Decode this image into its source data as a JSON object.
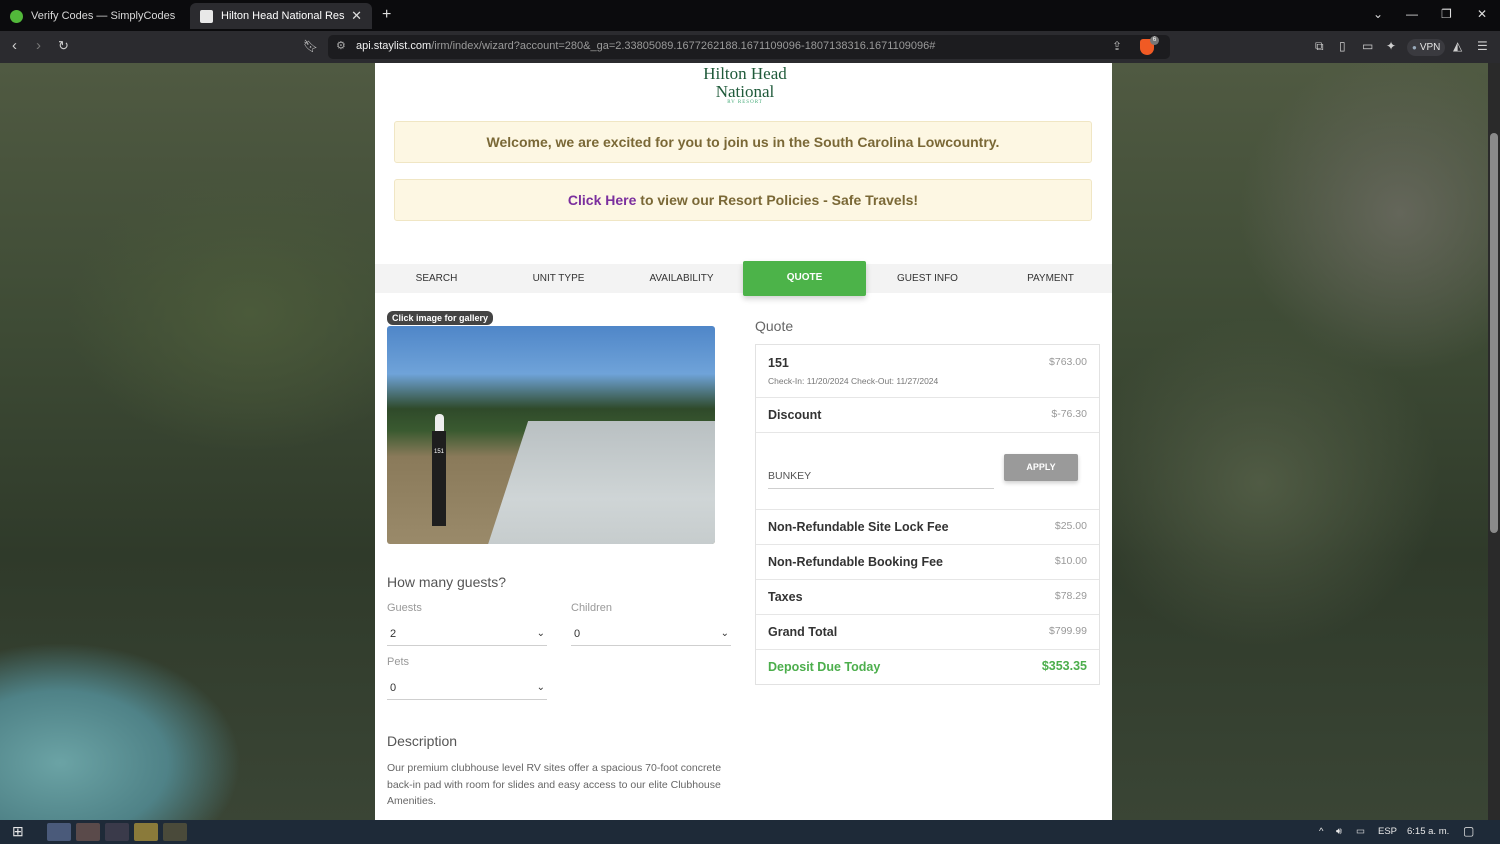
{
  "browser": {
    "tabs": [
      {
        "title": "Verify Codes — SimplyCodes",
        "active": false
      },
      {
        "title": "Hilton Head National Resort - C",
        "active": true
      }
    ],
    "url_host": "api.staylist.com",
    "url_path": "/irm/index/wizard?account=280&_ga=2.33805089.1677262188.1671109096-1807138316.1671109096#",
    "shield_badge": "6",
    "vpn_label": "VPN"
  },
  "brand": {
    "logo_line1": "Hilton Head",
    "logo_line2": "National",
    "logo_line3": "RV RESORT"
  },
  "notices": {
    "welcome": "Welcome, we are excited for you to join us in the South Carolina Lowcountry.",
    "policy_link": "Click Here",
    "policy_text": " to view our Resort Policies - Safe Travels!"
  },
  "steps": [
    {
      "label": "SEARCH",
      "active": false
    },
    {
      "label": "UNIT TYPE",
      "active": false
    },
    {
      "label": "AVAILABILITY",
      "active": false
    },
    {
      "label": "QUOTE",
      "active": true
    },
    {
      "label": "GUEST INFO",
      "active": false
    },
    {
      "label": "PAYMENT",
      "active": false
    }
  ],
  "gallery": {
    "tag": "Click image for gallery",
    "site_number": "151"
  },
  "guests": {
    "heading": "How many guests?",
    "guests_label": "Guests",
    "guests_value": "2",
    "children_label": "Children",
    "children_value": "0",
    "pets_label": "Pets",
    "pets_value": "0"
  },
  "description": {
    "heading": "Description",
    "text": "Our premium clubhouse level RV sites offer a spacious 70-foot concrete back-in pad with room for slides and easy access to our elite Clubhouse Amenities."
  },
  "quote": {
    "title": "Quote",
    "site": {
      "name": "151",
      "value": "$763.00",
      "dates": "Check-In: 11/20/2024 Check-Out: 11/27/2024"
    },
    "discount": {
      "name": "Discount",
      "value": "$-76.30"
    },
    "promo": {
      "code": "BUNKEY",
      "apply_label": "APPLY"
    },
    "lines": [
      {
        "name": "Non-Refundable Site Lock Fee",
        "value": "$25.00"
      },
      {
        "name": "Non-Refundable Booking Fee",
        "value": "$10.00"
      },
      {
        "name": "Taxes",
        "value": "$78.29"
      },
      {
        "name": "Grand Total",
        "value": "$799.99"
      }
    ],
    "deposit": {
      "name": "Deposit Due Today",
      "value": "$353.35"
    }
  },
  "taskbar": {
    "lang": "ESP",
    "time": "6:15 a. m."
  },
  "colors": {
    "accent_green": "#4cb349",
    "notice_bg": "#fdf7e3",
    "link_purple": "#7b2f9e"
  }
}
